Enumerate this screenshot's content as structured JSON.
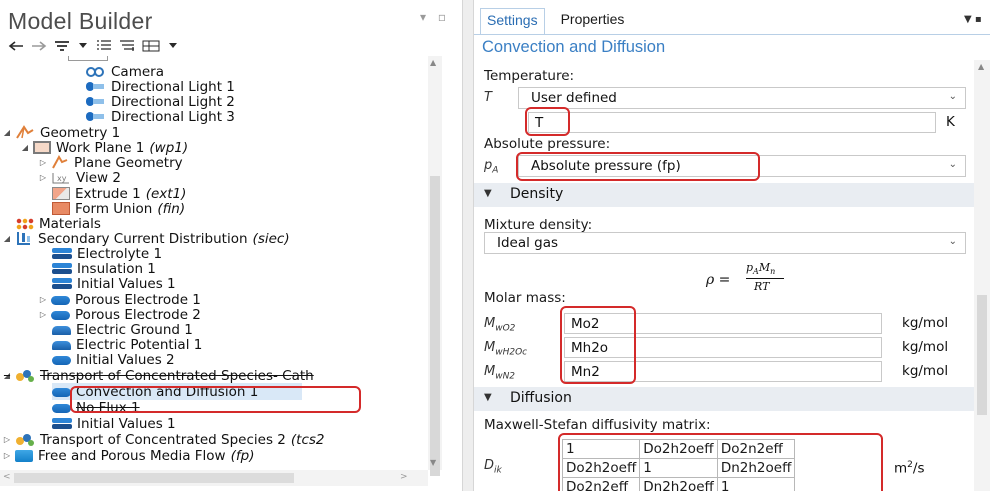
{
  "model_builder": {
    "title": "Model Builder",
    "toolbar_icons": [
      "back-arrow-icon",
      "forward-arrow-icon",
      "show-filter-icon",
      "dropdown-icon",
      "expand-sections-icon",
      "collapse-sections-icon",
      "tree-view-icon",
      "dropdown-icon"
    ],
    "tree": [
      {
        "label": "Camera",
        "tag": "",
        "icon": "camera-icon"
      },
      {
        "label": "Directional Light 1",
        "tag": "",
        "icon": "light-icon"
      },
      {
        "label": "Directional Light 2",
        "tag": "",
        "icon": "light-icon"
      },
      {
        "label": "Directional Light 3",
        "tag": "",
        "icon": "light-icon"
      },
      {
        "label": "Geometry 1",
        "tag": "",
        "icon": "geometry-icon"
      },
      {
        "label": "Work Plane 1",
        "tag": "(wp1)",
        "icon": "work-plane-icon"
      },
      {
        "label": "Plane Geometry",
        "tag": "",
        "icon": "plane-geometry-icon"
      },
      {
        "label": "View 2",
        "tag": "",
        "icon": "view-icon"
      },
      {
        "label": "Extrude 1",
        "tag": "(ext1)",
        "icon": "extrude-icon"
      },
      {
        "label": "Form Union",
        "tag": "(fin)",
        "icon": "form-union-icon"
      },
      {
        "label": "Materials",
        "tag": "",
        "icon": "materials-icon"
      },
      {
        "label": "Secondary Current Distribution",
        "tag": "(siec)",
        "icon": "physics-icon"
      },
      {
        "label": "Electrolyte 1",
        "tag": "",
        "icon": "feature-icon"
      },
      {
        "label": "Insulation 1",
        "tag": "",
        "icon": "feature-icon"
      },
      {
        "label": "Initial Values 1",
        "tag": "",
        "icon": "feature-icon"
      },
      {
        "label": "Porous Electrode 1",
        "tag": "",
        "icon": "feature-icon"
      },
      {
        "label": "Porous Electrode 2",
        "tag": "",
        "icon": "feature-icon"
      },
      {
        "label": "Electric Ground 1",
        "tag": "",
        "icon": "feature-icon"
      },
      {
        "label": "Electric Potential 1",
        "tag": "",
        "icon": "feature-icon"
      },
      {
        "label": "Initial Values 2",
        "tag": "",
        "icon": "feature-icon"
      },
      {
        "label": "Transport of Concentrated Species- Cath",
        "tag": "",
        "icon": "transport-icon"
      },
      {
        "label": "Convection and Diffusion 1",
        "tag": "",
        "icon": "feature-icon"
      },
      {
        "label": "No Flux 1",
        "tag": "",
        "icon": "feature-icon"
      },
      {
        "label": "Initial Values 1",
        "tag": "",
        "icon": "feature-icon"
      },
      {
        "label": "Transport of Concentrated Species 2",
        "tag": "(tcs2",
        "icon": "transport-icon"
      },
      {
        "label": "Free and Porous Media Flow",
        "tag": "(fp)",
        "icon": "flow-icon"
      }
    ]
  },
  "settings": {
    "tabs": [
      "Settings",
      "Properties"
    ],
    "active_tab": "Settings",
    "title": "Convection and Diffusion",
    "temperature": {
      "label": "Temperature:",
      "symbol": "T",
      "source": "User defined",
      "value": "T",
      "unit": "K"
    },
    "pressure": {
      "label": "Absolute pressure:",
      "symbol": "p",
      "symbol_sub": "A",
      "source": "Absolute pressure (fp)"
    },
    "density_section": {
      "title": "Density",
      "mixture_label": "Mixture density:",
      "mixture_value": "Ideal gas",
      "equation": {
        "lhs": "ρ =",
        "num_p": "p",
        "num_p_sub": "A",
        "num_m": "M",
        "num_m_sub": "n",
        "den": "RT"
      },
      "molar_label": "Molar mass:",
      "molar": [
        {
          "symbol": "M",
          "sub": "wO2",
          "value": "Mo2",
          "unit": "kg/mol"
        },
        {
          "symbol": "M",
          "sub": "wH2Oc",
          "value": "Mh2o",
          "unit": "kg/mol"
        },
        {
          "symbol": "M",
          "sub": "wN2",
          "value": "Mn2",
          "unit": "kg/mol"
        }
      ]
    },
    "diffusion_section": {
      "title": "Diffusion",
      "matrix_label": "Maxwell-Stefan diffusivity matrix:",
      "symbol": "D",
      "symbol_sub": "ik",
      "unit": "m",
      "unit_sup": "2",
      "unit_tail": "/s",
      "matrix": [
        [
          "1",
          "Do2h2oeff",
          "Do2n2eff"
        ],
        [
          "Do2h2oeff",
          "1",
          "Dn2h2oeff"
        ],
        [
          "Do2n2eff",
          "Dn2h2oeff",
          "1"
        ]
      ]
    }
  },
  "colors": {
    "accent": "#3a7fc4",
    "highlight": "#d42a2a",
    "section_bg": "#e9edf2",
    "selection_bg": "#d9e8f7"
  }
}
